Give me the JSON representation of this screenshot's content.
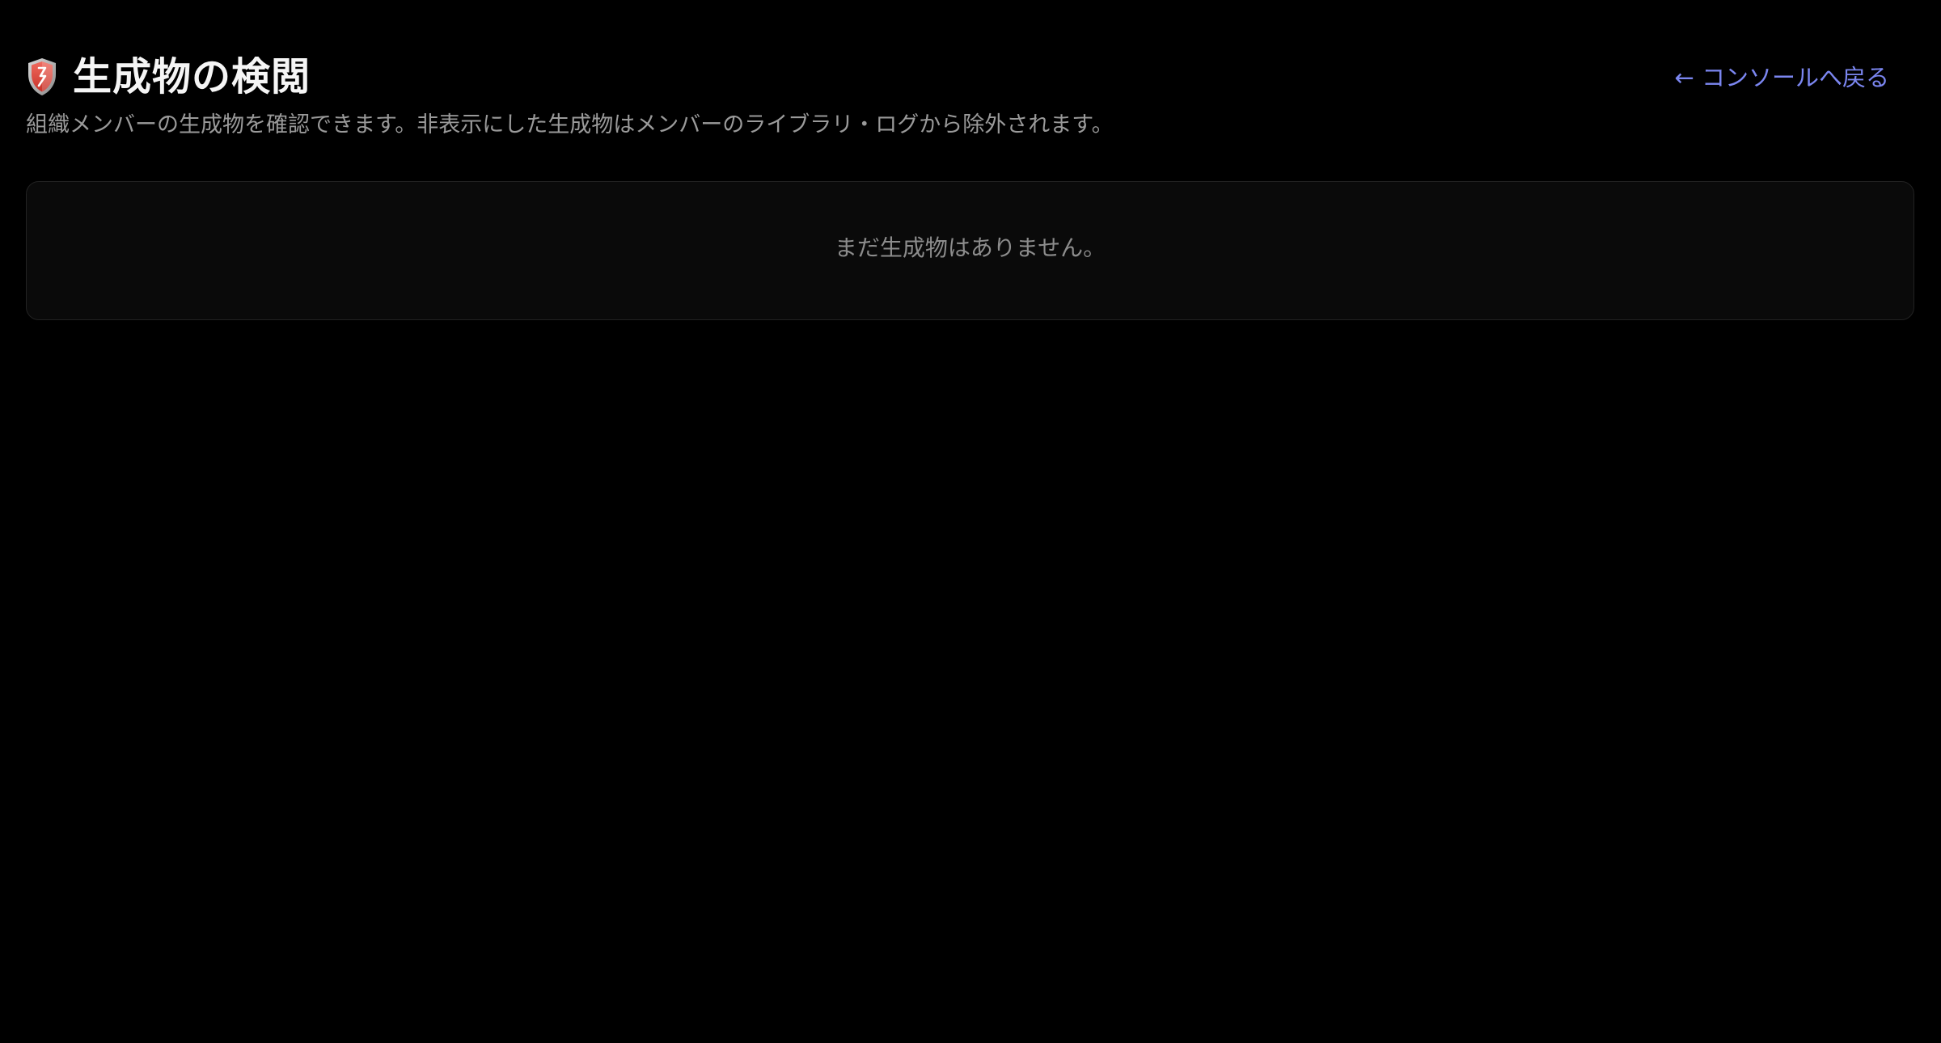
{
  "header": {
    "title": "生成物の検閲",
    "icon": "shield-icon",
    "subtitle": "組織メンバーの生成物を確認できます。非表示にした生成物はメンバーのライブラリ・ログから除外されます。",
    "back_link_label": "← コンソールへ戻る"
  },
  "main": {
    "empty_message": "まだ生成物はありません。"
  },
  "colors": {
    "background": "#000000",
    "title": "#f5f5f5",
    "subtitle": "#9a9a9a",
    "link": "#7b86f0",
    "card_border": "#222222",
    "card_background": "#0a0a0a",
    "shield_red": "#e0483e"
  }
}
